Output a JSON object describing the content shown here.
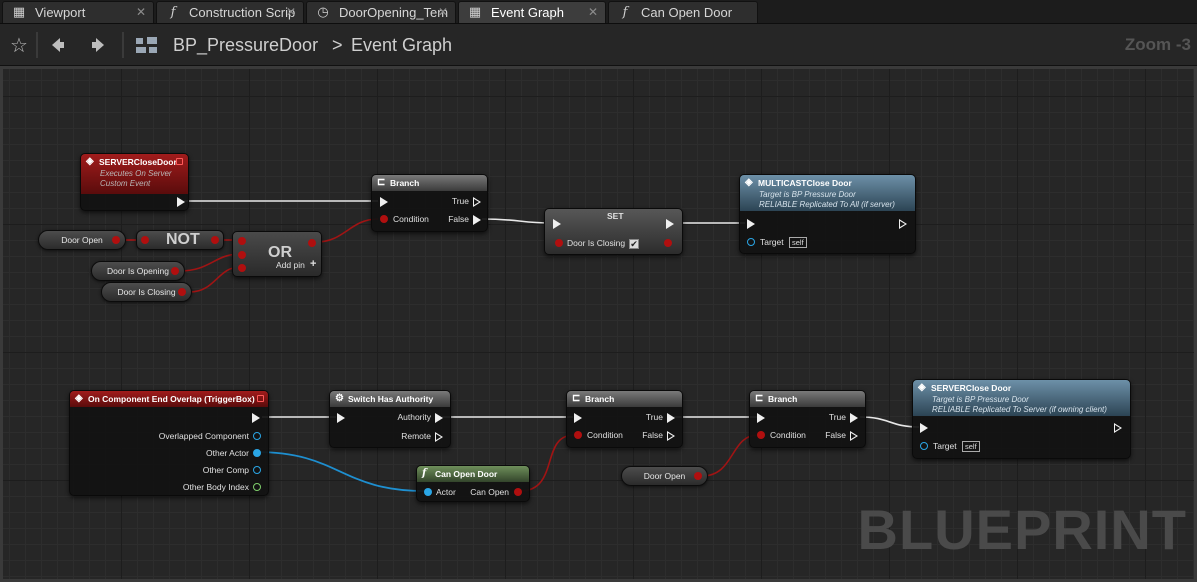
{
  "tabs": [
    {
      "label": "Viewport",
      "icon": "viewport-icon"
    },
    {
      "label": "Construction Scrip",
      "icon": "function-icon"
    },
    {
      "label": "DoorOpening_Tem",
      "icon": "timeline-icon"
    },
    {
      "label": "Event Graph",
      "icon": "event-graph-icon"
    },
    {
      "label": "Can Open Door",
      "icon": "function-icon"
    }
  ],
  "breadcrumb": {
    "blueprint": "BP_PressureDoor",
    "separator": ">",
    "graph": "Event Graph"
  },
  "zoom": "Zoom -3",
  "watermark": "BLUEPRINT",
  "nodes": {
    "server_close_event": {
      "title": "SERVERCloseDoor",
      "sub1": "Executes On Server",
      "sub2": "Custom Event"
    },
    "branch_top": {
      "title": "Branch",
      "true_label": "True",
      "condition_label": "Condition",
      "false_label": "False"
    },
    "set_node": {
      "title": "SET",
      "var_label": "Door Is Closing"
    },
    "multicast_close": {
      "title": "MULTICASTClose Door",
      "sub1": "Target is BP Pressure Door",
      "sub2": "RELIABLE Replicated To All (if server)",
      "target_label": "Target",
      "self_label": "self"
    },
    "door_open_getter_top": {
      "label": "Door Open"
    },
    "not_node": {
      "label": "NOT"
    },
    "or_node": {
      "label": "OR",
      "add_pin": "Add pin"
    },
    "door_is_opening_getter": {
      "label": "Door Is Opening"
    },
    "door_is_closing_getter": {
      "label": "Door Is Closing"
    },
    "end_overlap_event": {
      "title": "On Component End Overlap (TriggerBox)",
      "pins": [
        "Overlapped Component",
        "Other Actor",
        "Other Comp",
        "Other Body Index"
      ]
    },
    "switch_authority": {
      "title": "Switch Has Authority",
      "authority_label": "Authority",
      "remote_label": "Remote"
    },
    "can_open_door_fn": {
      "title": "Can Open Door",
      "actor_label": "Actor",
      "can_open_label": "Can Open"
    },
    "branch_mid": {
      "title": "Branch",
      "true_label": "True",
      "condition_label": "Condition",
      "false_label": "False"
    },
    "branch_right": {
      "title": "Branch",
      "true_label": "True",
      "condition_label": "Condition",
      "false_label": "False"
    },
    "door_open_getter_bottom": {
      "label": "Door Open"
    },
    "server_close_call": {
      "title": "SERVERClose Door",
      "sub1": "Target is BP Pressure Door",
      "sub2": "RELIABLE Replicated To Server (if owning client)",
      "target_label": "Target",
      "self_label": "self"
    }
  },
  "colors": {
    "exec_wire": "#e8e8e8",
    "bool_wire": "#a01414",
    "object_wire": "#1e8fd0",
    "event_header": "#a11c1c",
    "function_header": "#6d90a8",
    "pure_function_header": "#6e8f5a"
  }
}
